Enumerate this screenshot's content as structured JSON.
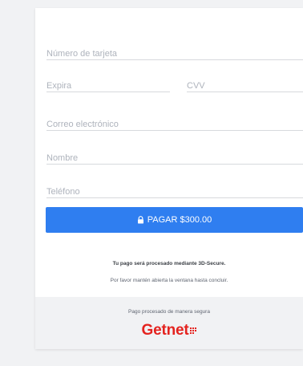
{
  "form": {
    "card_number_placeholder": "Número de tarjeta",
    "expiry_placeholder": "Expira",
    "cvv_placeholder": "CVV",
    "email_placeholder": "Correo electrónico",
    "name_placeholder": "Nombre",
    "phone_placeholder": "Teléfono"
  },
  "pay_button": {
    "label": "PAGAR $300.00",
    "icon": "lock-icon"
  },
  "notice": {
    "title": "Tu pago será procesado mediante 3D-Secure.",
    "subtitle": "Por favor mantén abierta la ventana hasta concluir."
  },
  "footer": {
    "text": "Pago procesado de manera segura",
    "brand": "Getnet"
  },
  "colors": {
    "accent": "#2f7ef0",
    "brand": "#e4231f",
    "background": "#f1f2f4"
  }
}
